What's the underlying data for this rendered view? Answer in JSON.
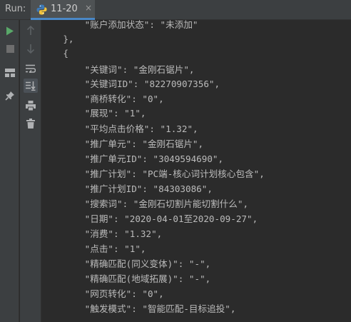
{
  "run_panel": {
    "label": "Run:",
    "tab": {
      "title": "11-20",
      "close_glyph": "×",
      "icon": "python-icon"
    }
  },
  "toolbar": {
    "left": [
      {
        "name": "run-icon",
        "color": "#59a869"
      },
      {
        "name": "stop-icon",
        "color": "#6e6e6e"
      },
      {
        "name": "layout-icon",
        "color": "#afb1b3"
      },
      {
        "name": "pin-icon",
        "color": "#afb1b3"
      }
    ],
    "inner": [
      {
        "name": "up-arrow-icon",
        "color": "#5c6164"
      },
      {
        "name": "down-arrow-icon",
        "color": "#5c6164"
      },
      {
        "name": "soft-wrap-icon",
        "color": "#afb1b3"
      },
      {
        "name": "scroll-to-end-icon",
        "color": "#afb1b3",
        "active": true
      },
      {
        "name": "print-icon",
        "color": "#afb1b3"
      },
      {
        "name": "trash-icon",
        "color": "#afb1b3"
      }
    ]
  },
  "console": {
    "text_color": "#bbbbbb",
    "lines": [
      "        \"账户添加状态\": \"未添加\"",
      "    },",
      "    {",
      "        \"关键词\": \"金刚石锯片\",",
      "        \"关键词ID\": \"82270907356\",",
      "        \"商桥转化\": \"0\",",
      "        \"展现\": \"1\",",
      "        \"平均点击价格\": \"1.32\",",
      "        \"推广单元\": \"金刚石锯片\",",
      "        \"推广单元ID\": \"3049594690\",",
      "        \"推广计划\": \"PC端-核心词计划核心包含\",",
      "        \"推广计划ID\": \"84303086\",",
      "        \"搜索词\": \"金刚石切割片能切割什么\",",
      "        \"日期\": \"2020-04-01至2020-09-27\",",
      "        \"消费\": \"1.32\",",
      "        \"点击\": \"1\",",
      "        \"精确匹配(同义变体)\": \"-\",",
      "        \"精确匹配(地域拓展)\": \"-\",",
      "        \"网页转化\": \"0\",",
      "        \"触发模式\": \"智能匹配-目标追投\","
    ]
  }
}
